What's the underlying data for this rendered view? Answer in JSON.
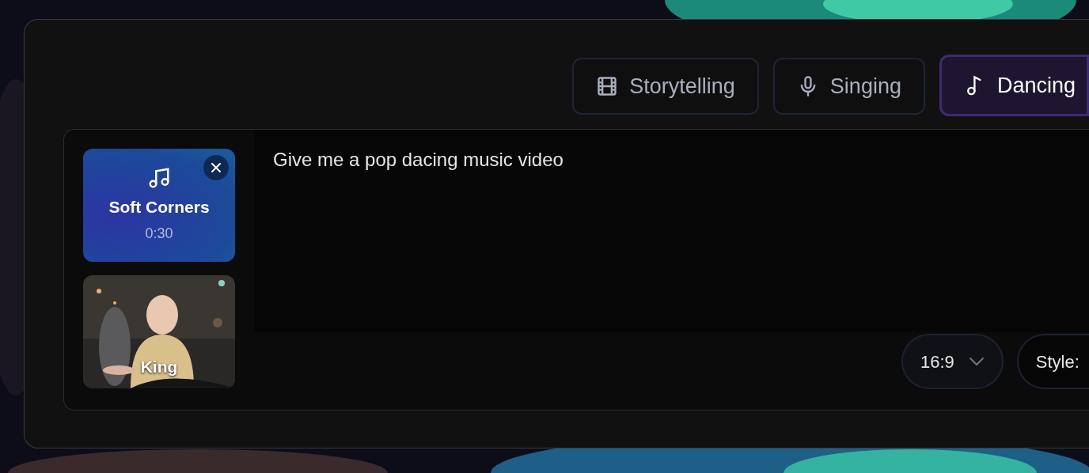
{
  "tabs": [
    {
      "label": "Storytelling",
      "selected": false
    },
    {
      "label": "Singing",
      "selected": false
    },
    {
      "label": "Dancing",
      "selected": true
    }
  ],
  "attachments": [
    {
      "kind": "audio",
      "title": "Soft Corners",
      "duration": "0:30",
      "removable": true
    },
    {
      "kind": "picture",
      "title": "King"
    }
  ],
  "prompt": {
    "value": "Give me a pop dacing music video"
  },
  "aspect_ratio": {
    "value": "16:9"
  },
  "style": {
    "label": "Style:"
  }
}
